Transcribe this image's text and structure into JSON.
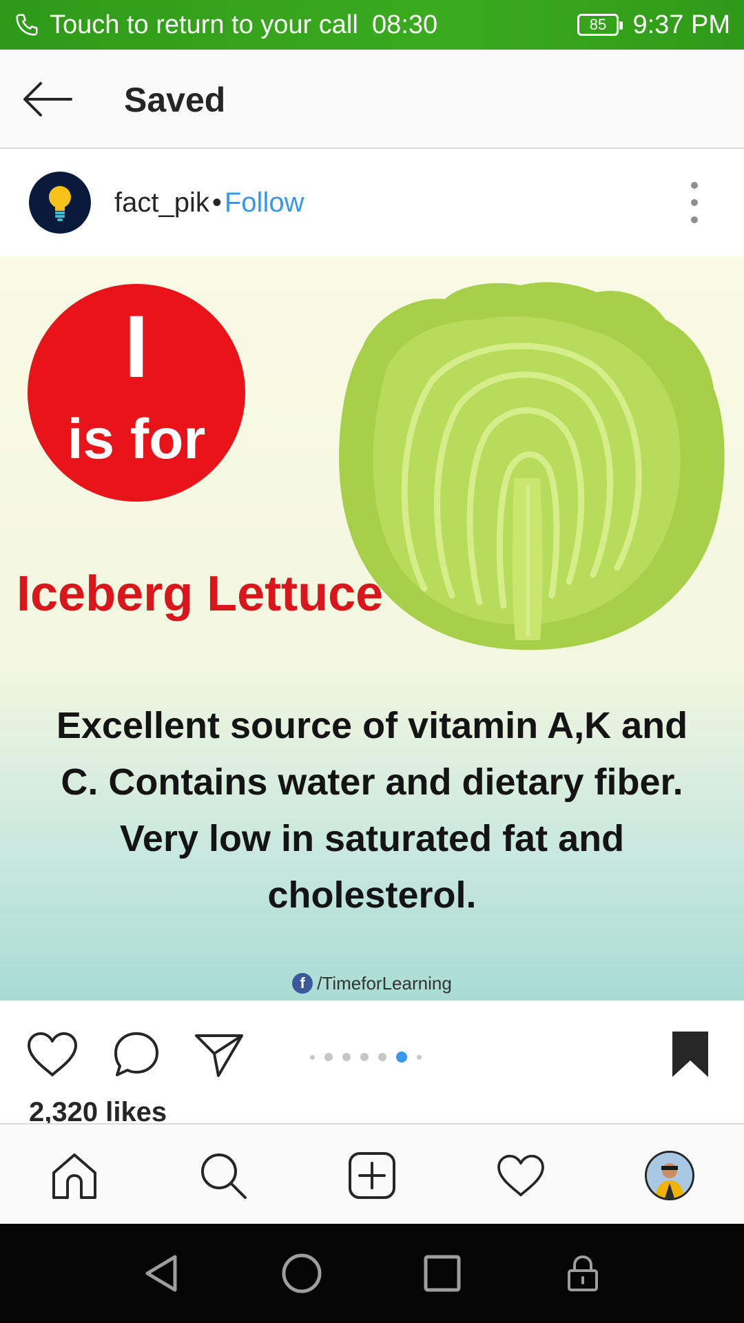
{
  "status_bar": {
    "call_text": "Touch to return to your call",
    "call_timer": "08:30",
    "battery": "85",
    "time": "9:37 PM"
  },
  "header": {
    "title": "Saved"
  },
  "post": {
    "username": "fact_pik",
    "separator": "•",
    "follow_label": "Follow",
    "image": {
      "letter": "I",
      "is_for": "is for",
      "name": "Iceberg Lettuce",
      "fact": "Excellent source of vitamin A,K and C. Contains water and dietary fiber. Very low in saturated fat and cholesterol.",
      "watermark": "/TimeforLearning",
      "fb_glyph": "f"
    },
    "carousel": {
      "count": 7,
      "active_index": 5
    },
    "likes": "2,320 likes"
  },
  "colors": {
    "status_green": "#3aab1f",
    "accent_blue": "#3897f0",
    "circle_red": "#e9141a",
    "title_red": "#d8161c",
    "lettuce_green": "#b7dc5c"
  },
  "icons": {
    "header": [
      "back-arrow-icon"
    ],
    "actions": [
      "heart-icon",
      "comment-icon",
      "share-icon",
      "bookmark-icon"
    ],
    "bottom_nav": [
      "home-icon",
      "search-icon",
      "add-post-icon",
      "activity-heart-icon",
      "profile-icon"
    ],
    "system_nav": [
      "back-triangle-icon",
      "home-circle-icon",
      "recents-square-icon",
      "lock-icon"
    ]
  }
}
